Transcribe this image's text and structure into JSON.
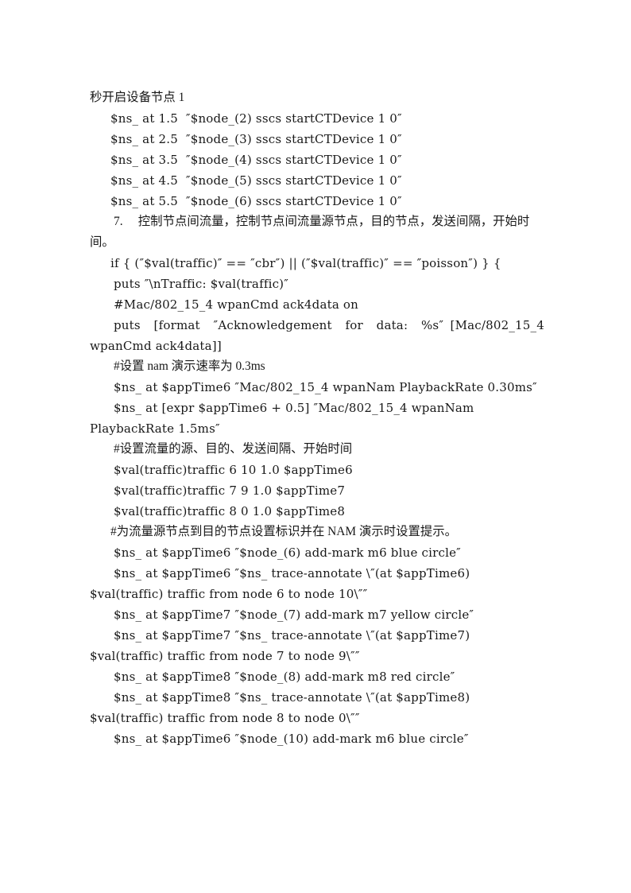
{
  "document": {
    "page_background": "#ffffff",
    "text_color": "#181818",
    "lines": [
      {
        "id": "l1",
        "text": "秒开启设备节点 1",
        "style": "cn",
        "indent": 0
      },
      {
        "id": "l2",
        "text": "$ns_ at 1.5  ″$node_(2) sscs startCTDevice 1 0″",
        "style": "code",
        "indent": 1
      },
      {
        "id": "l3",
        "text": "$ns_ at 2.5  ″$node_(3) sscs startCTDevice 1 0″",
        "style": "code",
        "indent": 1
      },
      {
        "id": "l4",
        "text": "$ns_ at 3.5  ″$node_(4) sscs startCTDevice 1 0″",
        "style": "code",
        "indent": 1
      },
      {
        "id": "l5",
        "text": "$ns_ at 4.5  ″$node_(5) sscs startCTDevice 1 0″",
        "style": "code",
        "indent": 1
      },
      {
        "id": "l6",
        "text": "$ns_ at 5.5  ″$node_(6) sscs startCTDevice 1 0″",
        "style": "code",
        "indent": 1
      },
      {
        "id": "l7",
        "text": "7.  控制节点间流量，控制节点间流量源节点，目的节点，发送间隔，开始时间。",
        "style": "cn",
        "indent": 0,
        "hanging": true
      },
      {
        "id": "l8",
        "text": "if { (″$val(traffic)″ == ″cbr″) || (″$val(traffic)″ == ″poisson″) } {",
        "style": "code",
        "indent": 1,
        "hanging": true
      },
      {
        "id": "l9",
        "text": "puts ″\\nTraffic: $val(traffic)″",
        "style": "code",
        "indent": 2
      },
      {
        "id": "l10",
        "text": "#Mac/802_15_4 wpanCmd ack4data on",
        "style": "code",
        "indent": 2
      },
      {
        "id": "l11",
        "text": "puts  [format  ″Acknowledgement  for  data:  %s″ [Mac/802_15_4 wpanCmd ack4data]]",
        "style": "code",
        "indent": 2,
        "hanging": true,
        "justify_first": true
      },
      {
        "id": "l12",
        "text": "#设置 nam 演示速率为 0.3ms",
        "style": "cn",
        "indent": 2
      },
      {
        "id": "l13",
        "text": "$ns_ at $appTime6 ″Mac/802_15_4 wpanNam PlaybackRate 0.30ms″",
        "style": "code",
        "indent": 2,
        "hanging": true
      },
      {
        "id": "l14",
        "text": "$ns_ at [expr $appTime6 + 0.5] ″Mac/802_15_4 wpanNam PlaybackRate 1.5ms″",
        "style": "code",
        "indent": 2,
        "hanging": true
      },
      {
        "id": "l15",
        "text": "#设置流量的源、目的、发送间隔、开始时间",
        "style": "cn",
        "indent": 2
      },
      {
        "id": "l16",
        "text": "$val(traffic)traffic 6 10 1.0 $appTime6",
        "style": "code",
        "indent": 2
      },
      {
        "id": "l17",
        "text": "$val(traffic)traffic 7 9 1.0 $appTime7",
        "style": "code",
        "indent": 2
      },
      {
        "id": "l18",
        "text": "$val(traffic)traffic 8 0 1.0 $appTime8",
        "style": "code",
        "indent": 2
      },
      {
        "id": "l19",
        "text": "#为流量源节点到目的节点设置标识并在 NAM 演示时设置提示。",
        "style": "cn",
        "indent": 1
      },
      {
        "id": "l20",
        "text": "$ns_ at $appTime6 ″$node_(6) add-mark m6 blue circle″",
        "style": "code",
        "indent": 2
      },
      {
        "id": "l21",
        "text": "$ns_ at $appTime6 ″$ns_ trace-annotate \\″(at $appTime6) $val(traffic) traffic from node 6 to node 10\\″″",
        "style": "code",
        "indent": 2,
        "hanging": true
      },
      {
        "id": "l22",
        "text": "$ns_ at $appTime7 ″$node_(7) add-mark m7 yellow circle″",
        "style": "code",
        "indent": 2
      },
      {
        "id": "l23",
        "text": "$ns_ at $appTime7 ″$ns_ trace-annotate \\″(at $appTime7) $val(traffic) traffic from node 7 to node 9\\″″",
        "style": "code",
        "indent": 2,
        "hanging": true
      },
      {
        "id": "l24",
        "text": "$ns_ at $appTime8 ″$node_(8) add-mark m8 red circle″",
        "style": "code",
        "indent": 2
      },
      {
        "id": "l25",
        "text": "$ns_ at $appTime8 ″$ns_ trace-annotate \\″(at $appTime8) $val(traffic) traffic from node 8 to node 0\\″″",
        "style": "code",
        "indent": 2,
        "hanging": true
      },
      {
        "id": "l26",
        "text": "$ns_ at $appTime6 ″$node_(10) add-mark m6 blue circle″",
        "style": "code",
        "indent": 2
      }
    ]
  }
}
